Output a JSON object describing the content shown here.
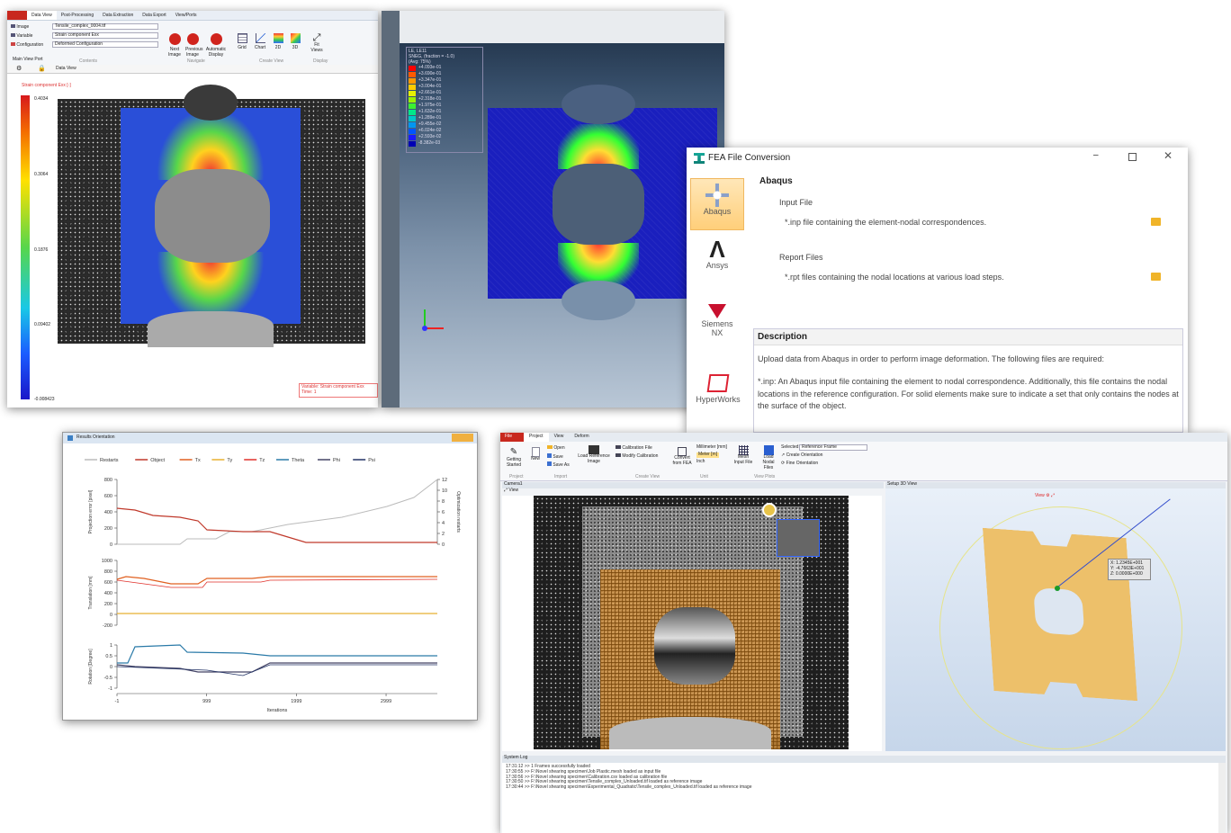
{
  "dic": {
    "tabs": [
      "Data View",
      "Post-Processing",
      "Data Extraction",
      "Data Export",
      "View/Ports"
    ],
    "fields": [
      {
        "label": "Image",
        "value": "Tensile_complex_0004.tif"
      },
      {
        "label": "Variable",
        "value": "Strain component Exx"
      },
      {
        "label": "Configuration",
        "value": "Deformed Configuration"
      }
    ],
    "tools": [
      "Next Image",
      "Previous Image",
      "Automatic Display",
      "Grid",
      "Chart",
      "2D",
      "3D",
      "Fit Views"
    ],
    "groups": [
      "Contents",
      "Navigate",
      "Create View",
      "Display"
    ],
    "tree_label": "Main View Port",
    "view_label": "Data View",
    "plot_title": "Strain component Exx [-]",
    "scale": [
      "0.4034",
      "0.3064",
      "0.1876",
      "0.09402",
      "-0.008423"
    ],
    "info_line1": "Variable: Strain component Exx",
    "info_line2": "Time: 1",
    "bar_colors": [
      "#d7191c",
      "#f46d00",
      "#ffe100",
      "#57d64b",
      "#19c8e6",
      "#1b5cff",
      "#1a17c9"
    ]
  },
  "fea": {
    "legend_head": [
      "LE, LE11",
      "SNEG, (fraction = -1.0)",
      "(Avg: 75%)"
    ],
    "legend_values": [
      "+4.093e-01",
      "+3.690e-01",
      "+3.347e-01",
      "+3.004e-01",
      "+2.661e-01",
      "+2.318e-01",
      "+1.975e-01",
      "+1.632e-01",
      "+1.289e-01",
      "+9.455e-02",
      "+6.024e-02",
      "+2.593e-02",
      "-8.382e-03"
    ],
    "legend_colors": [
      "#ff0000",
      "#ff5a00",
      "#ff9900",
      "#ffcc00",
      "#e6f000",
      "#9cf000",
      "#3cf032",
      "#00e88a",
      "#00c8c8",
      "#0096f0",
      "#0055ff",
      "#1a1aff",
      "#0000b4"
    ]
  },
  "conv": {
    "title": "FEA File Conversion",
    "sidebar": [
      "Abaqus",
      "Ansys",
      "Siemens NX",
      "HyperWorks"
    ],
    "heading": "Abaqus",
    "input_title": "Input File",
    "input_desc": "*.inp file containing the element-nodal correspondences.",
    "report_title": "Report Files",
    "report_desc": "*.rpt files containing the nodal locations at various load steps.",
    "desc_title": "Description",
    "desc_p1": "Upload data from Abaqus in order to perform image deformation. The following files are required:",
    "desc_p2": "*.inp: An Abaqus input file containing the element to nodal correspondence. Additionally, this file contains the nodal locations in the reference configuration. For solid elements make sure to indicate a set that only contains the nodes at the surface of the object."
  },
  "results": {
    "title": "Results Orientation",
    "legend": [
      {
        "name": "Restarts",
        "color": "#bbbbbb"
      },
      {
        "name": "Object",
        "color": "#c0392b"
      },
      {
        "name": "Tx",
        "color": "#e06020"
      },
      {
        "name": "Ty",
        "color": "#e8b030"
      },
      {
        "name": "Tz",
        "color": "#e0302a"
      },
      {
        "name": "Theta",
        "color": "#2a7aa8"
      },
      {
        "name": "Phi",
        "color": "#444466"
      },
      {
        "name": "Psi",
        "color": "#223366"
      }
    ],
    "y1_label": "Projection error [pixel]",
    "y1_ticks": [
      "800",
      "600",
      "400",
      "200",
      "0"
    ],
    "y1r_label": "Optimization restarts",
    "y1r_ticks": [
      "12",
      "10",
      "8",
      "6",
      "4",
      "2",
      "0"
    ],
    "y2_label": "Translation [mm]",
    "y2_ticks": [
      "1000",
      "800",
      "600",
      "400",
      "200",
      "0",
      "-200"
    ],
    "y3_label": "Rotation [Degree]",
    "y3_ticks": [
      "1",
      "0.5",
      "0",
      "-0.5",
      "-1"
    ],
    "x_ticks": [
      "-1",
      "999",
      "1999",
      "2999"
    ],
    "x_label": "Iterations"
  },
  "cal": {
    "tabs": [
      "File",
      "Project",
      "View",
      "Deform"
    ],
    "tools": [
      "Getting Started",
      "New",
      "Open",
      "Save",
      "Save As",
      "Load Reference Image",
      "Calibration File",
      "Modify Calibration",
      "Convert from FEA",
      "Millimeter [mm]",
      "Meter [m]",
      "Inch",
      "Mesh Input File",
      "Load Nodal Files",
      "Create Orientation",
      "Fine Orientation"
    ],
    "selected_label": "Selected:",
    "selected_value": "Reference Frame",
    "groups": [
      "Project",
      "Import",
      "Unit",
      "Create View",
      "View Plots"
    ],
    "left_title": "Camera1",
    "view_btn": "View",
    "right_title": "Setup 3D View",
    "view3d_btn": "View",
    "tip": [
      "X: 1.2345E+001",
      "Y: -4.7663E+001",
      "Z: 0.0000E+000"
    ],
    "log_title": "System Log",
    "log": [
      "17:31:12 >> 1 Frames successfully loaded",
      "17:30:55 >> F:\\Novel shearing specimen\\Job Plastic.mesh loaded as input file",
      "17:30:56 >> F:\\Novel shearing specimen\\Calibration.csv loaded as calibration file",
      "17:30:50 >> F:\\Novel shearing specimen\\Tensile_complex_Unloaded.tif loaded as reference image",
      "17:30:44 >> F:\\Novel shearing specimen\\Experimental_Quadratic\\Tensile_complex_Unloaded.tif loaded as reference image"
    ]
  }
}
